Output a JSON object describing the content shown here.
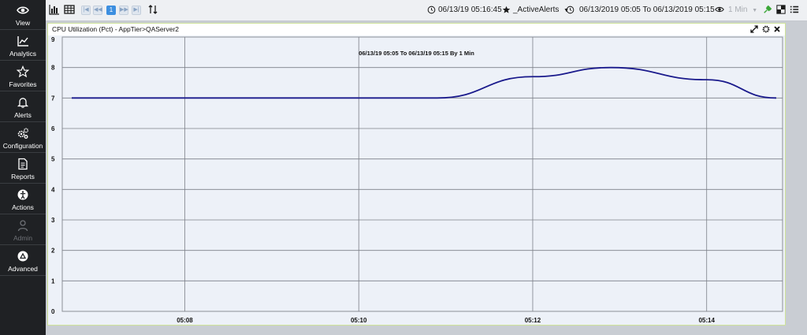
{
  "sidebar": {
    "items": [
      {
        "label": "View",
        "icon": "eye-icon",
        "disabled": false
      },
      {
        "label": "Analytics",
        "icon": "line-chart-icon",
        "disabled": false
      },
      {
        "label": "Favorites",
        "icon": "star-icon",
        "disabled": false
      },
      {
        "label": "Alerts",
        "icon": "bell-icon",
        "disabled": false
      },
      {
        "label": "Configuration",
        "icon": "gears-icon",
        "disabled": false
      },
      {
        "label": "Reports",
        "icon": "report-icon",
        "disabled": false
      },
      {
        "label": "Actions",
        "icon": "actions-icon",
        "disabled": false
      },
      {
        "label": "Admin",
        "icon": "user-icon",
        "disabled": true
      },
      {
        "label": "Advanced",
        "icon": "advanced-icon",
        "disabled": false
      }
    ]
  },
  "toolbar": {
    "page_number": "1",
    "current_time": "06/13/19 05:16:45",
    "favorite_label": "_ActiveAlerts",
    "time_range": "06/13/2019 05:05 To 06/13/2019 05:15",
    "interval": "1 Min"
  },
  "panel": {
    "title": "CPU Utilization (Pct) - AppTier>QAServer2"
  },
  "colors": {
    "sidebar_bg": "#1f2124",
    "series_line": "#1a1a8c",
    "chart_bg": "#edf1f8",
    "page_button": "#3d8fe0",
    "panel_border": "#cfe39a"
  },
  "chart_data": {
    "type": "line",
    "subtitle": "06/13/19 05:05 To 06/13/19 05:15 By 1 Min",
    "x_tick_labels": [
      "05:08",
      "05:10",
      "05:12",
      "05:14"
    ],
    "y_tick_labels": [
      "0",
      "1",
      "2",
      "3",
      "4",
      "5",
      "6",
      "7",
      "8",
      "9"
    ],
    "ylim": [
      0,
      9
    ],
    "xlim_minutes": [
      "05:06.7",
      "05:14.8"
    ],
    "grid": true,
    "legend": "none",
    "series": [
      {
        "points": [
          {
            "x": "05:06.7",
            "y": 7.0
          },
          {
            "x": "05:10.0",
            "y": 7.0
          },
          {
            "x": "05:10.9",
            "y": 7.0
          },
          {
            "x": "05:12.0",
            "y": 7.7
          },
          {
            "x": "05:12.9",
            "y": 8.0
          },
          {
            "x": "05:14.0",
            "y": 7.6
          },
          {
            "x": "05:14.8",
            "y": 7.0
          }
        ]
      }
    ]
  }
}
